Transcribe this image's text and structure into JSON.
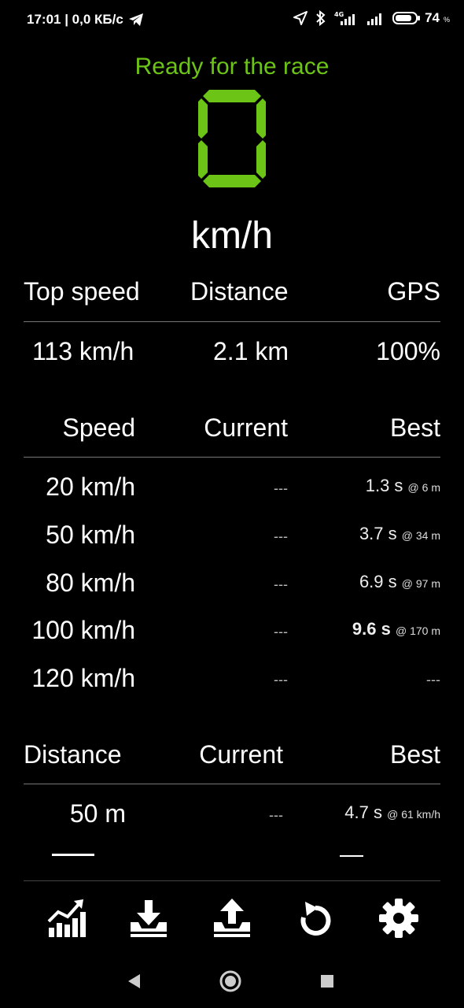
{
  "statusbar": {
    "time_speed": "17:01 | 0,0 КБ/с",
    "battery": "74",
    "battery_unit": "%",
    "net_type": "4G"
  },
  "header": {
    "status": "Ready for the race",
    "speed_digit": "0",
    "unit": "km/h",
    "accent_color": "#6cc417"
  },
  "summary": {
    "headers": [
      "Top speed",
      "Distance",
      "GPS"
    ],
    "values": [
      "113 km/h",
      "2.1 km",
      "100%"
    ]
  },
  "speed_table": {
    "headers": [
      "Speed",
      "Current",
      "Best"
    ],
    "rows": [
      {
        "label": "20 km/h",
        "current": "---",
        "best": "1.3 s",
        "at": "@ 6 m"
      },
      {
        "label": "50 km/h",
        "current": "---",
        "best": "3.7 s",
        "at": "@ 34 m"
      },
      {
        "label": "80 km/h",
        "current": "---",
        "best": "6.9 s",
        "at": "@ 97 m"
      },
      {
        "label": "100 km/h",
        "current": "---",
        "best": "9.6 s",
        "at": "@ 170 m"
      },
      {
        "label": "120 km/h",
        "current": "---",
        "best": "---",
        "at": ""
      }
    ]
  },
  "distance_table": {
    "headers": [
      "Distance",
      "Current",
      "Best"
    ],
    "rows": [
      {
        "label": "50 m",
        "current": "---",
        "best": "4.7 s",
        "at": "@ 61 km/h"
      }
    ]
  },
  "toolbar": {
    "icons": [
      "chart-icon",
      "download-icon",
      "upload-icon",
      "reset-icon",
      "settings-icon"
    ]
  }
}
